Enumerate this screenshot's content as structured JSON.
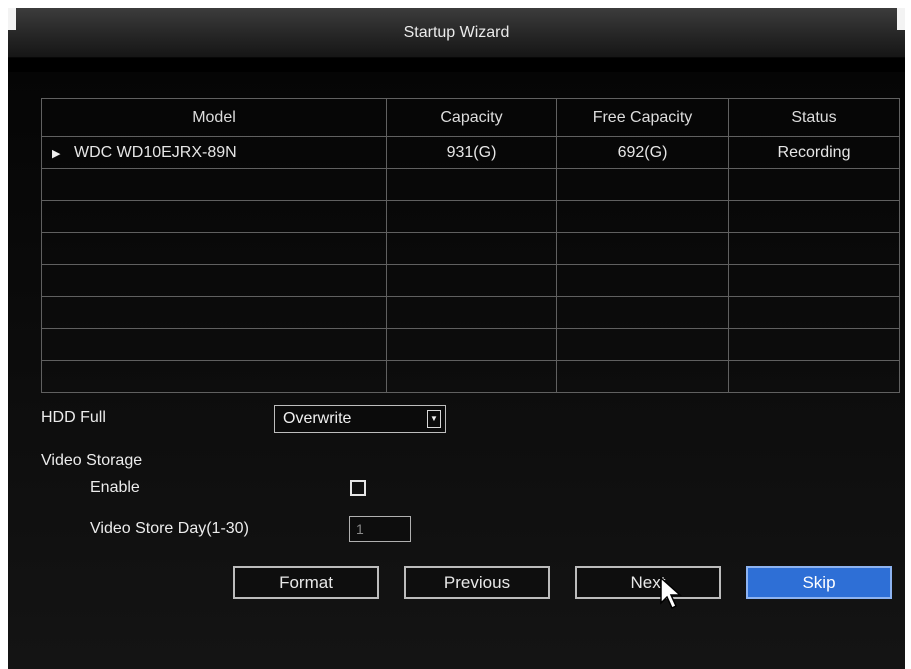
{
  "window": {
    "title": "Startup Wizard"
  },
  "hdd_table": {
    "columns": [
      "Model",
      "Capacity",
      "Free Capacity",
      "Status"
    ],
    "rows": [
      {
        "model": "WDC WD10EJRX-89N",
        "capacity": "931(G)",
        "free_capacity": "692(G)",
        "status": "Recording"
      }
    ]
  },
  "hdd_full": {
    "label": "HDD Full",
    "value": "Overwrite"
  },
  "video_storage": {
    "label": "Video Storage",
    "enable_label": "Enable",
    "enable_checked": false,
    "store_day_label": "Video Store Day(1-30)",
    "store_day_value": "1"
  },
  "buttons": {
    "format": "Format",
    "previous": "Previous",
    "next": "Next",
    "skip": "Skip"
  },
  "icons": {
    "row_marker": "play-arrow-icon",
    "dropdown": "chevron-down-icon",
    "cursor": "mouse-pointer-icon"
  },
  "colors": {
    "background": "#000000",
    "skip_button": "#2e6fd6"
  }
}
